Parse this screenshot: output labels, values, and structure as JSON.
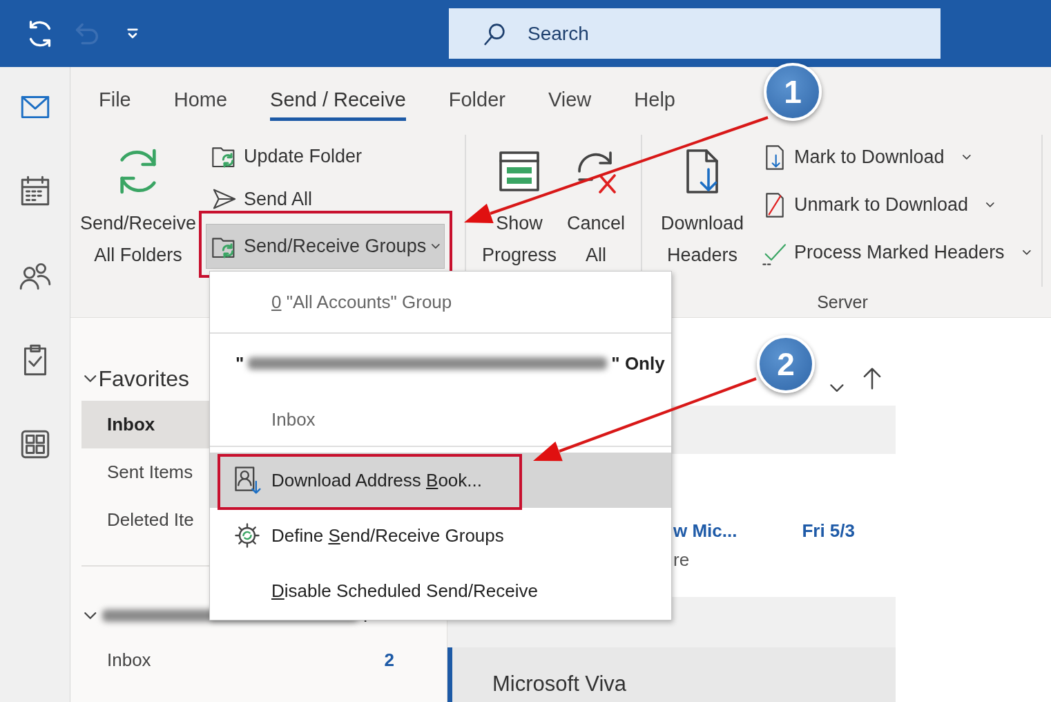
{
  "quick_access": [
    {
      "kind": "sync",
      "disabled": false
    },
    {
      "kind": "undo",
      "disabled": true
    },
    {
      "kind": "customize",
      "disabled": false
    }
  ],
  "search": {
    "placeholder": "Search"
  },
  "nav_rail": [
    {
      "kind": "mail",
      "selected": true
    },
    {
      "kind": "calendar",
      "selected": false
    },
    {
      "kind": "people",
      "selected": false
    },
    {
      "kind": "tasks",
      "selected": false
    },
    {
      "kind": "apps",
      "selected": false
    }
  ],
  "tabs": [
    {
      "label": "File",
      "selected": false
    },
    {
      "label": "Home",
      "selected": false
    },
    {
      "label": "Send / Receive",
      "selected": true
    },
    {
      "label": "Folder",
      "selected": false
    },
    {
      "label": "View",
      "selected": false
    },
    {
      "label": "Help",
      "selected": false
    }
  ],
  "ribbon": {
    "send_receive": {
      "big_button": {
        "kind": "sync",
        "lines": [
          "Send/Receive",
          "All Folders"
        ]
      },
      "small_buttons": [
        {
          "kind": "update",
          "label": "Update Folder",
          "pressed": false
        },
        {
          "kind": "send",
          "label": "Send All",
          "pressed": false
        },
        {
          "kind": "groups",
          "label": "Send/Receive Groups",
          "pressed": true,
          "annotated": true,
          "dropdown": true
        }
      ]
    },
    "progress": {
      "buttons": [
        {
          "kind": "progress",
          "lines": [
            "Show",
            "Progress"
          ]
        },
        {
          "kind": "cancel",
          "lines": [
            "Cancel",
            "All"
          ]
        }
      ]
    },
    "server": {
      "label": "Server",
      "big_button": {
        "kind": "headers",
        "lines": [
          "Download",
          "Headers"
        ]
      },
      "small_buttons": [
        {
          "kind": "mark",
          "label": "Mark to Download",
          "dropdown": true
        },
        {
          "kind": "unmark",
          "label": "Unmark to Download",
          "dropdown": true
        },
        {
          "kind": "process",
          "label": "Process Marked Headers",
          "dropdown": true
        }
      ]
    }
  },
  "folders": {
    "favorites": {
      "label": "Favorites",
      "expanded": true,
      "items": [
        {
          "label": "Inbox",
          "selected": true
        },
        {
          "label": "Sent Items",
          "selected": false
        },
        {
          "label": "Deleted Ite",
          "selected": false
        }
      ]
    },
    "account": {
      "name_tail": ".",
      "expanded": true,
      "items": [
        {
          "label": "Inbox",
          "count": "2",
          "selected": false
        }
      ]
    }
  },
  "messages": [
    {
      "sender": "w Mic...",
      "date": "Fri 5/3",
      "preview": "re",
      "unread": true,
      "selected": false
    },
    {
      "sender": "Microsoft Viva",
      "unread": false,
      "selected": true
    }
  ],
  "menu": {
    "items": [
      {
        "kind": "item",
        "access_key": "0",
        "after": " \"All Accounts\" Group",
        "disabled": true,
        "highlighted": false
      },
      {
        "kind": "separator"
      },
      {
        "kind": "header",
        "quote_open": "\"",
        "label": "\" Only"
      },
      {
        "kind": "item",
        "label": "Inbox",
        "disabled": true,
        "highlighted": false
      },
      {
        "kind": "separator"
      },
      {
        "kind": "address-book",
        "before": "Download Address ",
        "access_key": "B",
        "after": "ook...",
        "disabled": false,
        "highlighted": true,
        "annotated": true
      },
      {
        "kind": "define",
        "before": "Define ",
        "access_key": "S",
        "after": "end/Receive Groups",
        "disabled": false,
        "highlighted": false
      },
      {
        "kind": "item",
        "access_key": "D",
        "after": "isable Scheduled Send/Receive",
        "disabled": false,
        "highlighted": false
      }
    ]
  },
  "callouts": [
    {
      "number": "1"
    },
    {
      "number": "2"
    }
  ]
}
